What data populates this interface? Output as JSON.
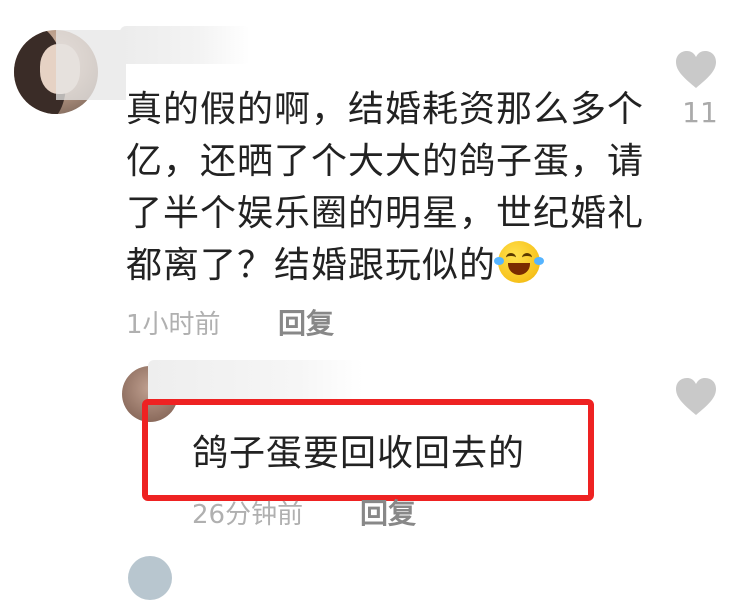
{
  "comments": [
    {
      "text": "真的假的啊，结婚耗资那么多个亿，还晒了个大大的鸽子蛋，请了半个娱乐圈的明星，世纪婚礼都离了？结婚跟玩似的",
      "emoji": "rolling-on-floor-laughing",
      "time": "1小时前",
      "reply_label": "回复",
      "likes": "11",
      "replies": [
        {
          "text": "鸽子蛋要回收回去的",
          "time": "26分钟前",
          "reply_label": "回复",
          "highlighted": true,
          "highlight_color": "#ee2222"
        }
      ]
    }
  ],
  "colors": {
    "text": "#222222",
    "meta": "#b0b0b0",
    "reply": "#888888",
    "heart": "#c9c9c9"
  },
  "icons": {
    "like": "heart-icon"
  }
}
